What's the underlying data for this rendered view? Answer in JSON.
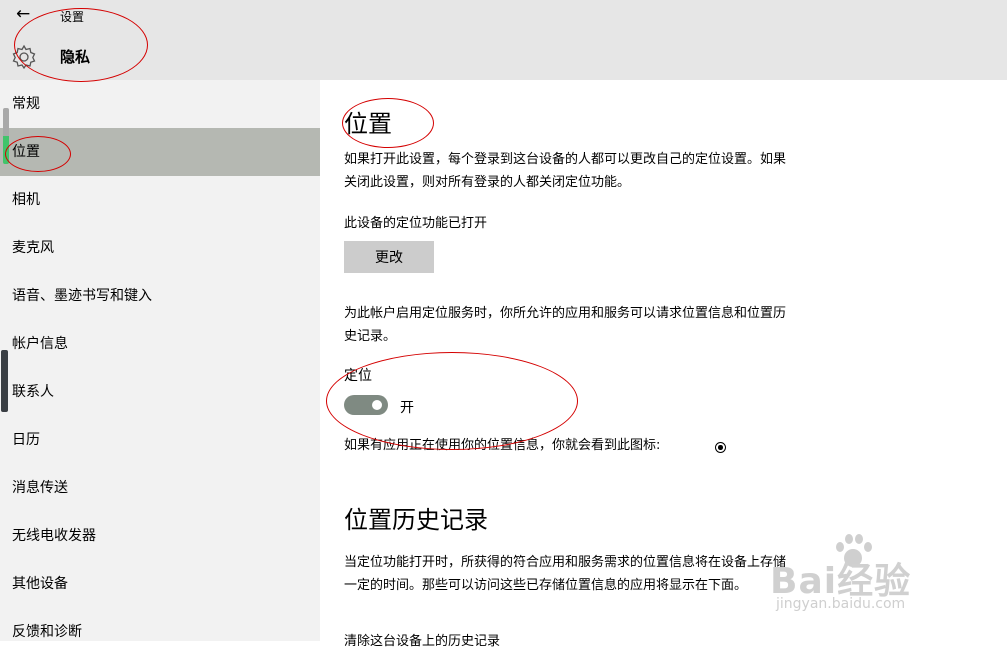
{
  "header": {
    "window_title": "设置",
    "page_heading": "隐私"
  },
  "sidebar": {
    "items": [
      {
        "label": "常规"
      },
      {
        "label": "位置"
      },
      {
        "label": "相机"
      },
      {
        "label": "麦克风"
      },
      {
        "label": "语音、墨迹书写和键入"
      },
      {
        "label": "帐户信息"
      },
      {
        "label": "联系人"
      },
      {
        "label": "日历"
      },
      {
        "label": "消息传送"
      },
      {
        "label": "无线电收发器"
      },
      {
        "label": "其他设备"
      },
      {
        "label": "反馈和诊断"
      }
    ],
    "selected": "位置"
  },
  "main": {
    "section_title": "位置",
    "intro_text": "如果打开此设置，每个登录到这台设备的人都可以更改自己的定位设置。如果关闭此设置，则对所有登录的人都关闭定位功能。",
    "device_status": "此设备的定位功能已打开",
    "change_button": "更改",
    "account_text": "为此帐户启用定位服务时，你所允许的应用和服务可以请求位置信息和位置历史记录。",
    "location_label": "定位",
    "toggle_state": "开",
    "toggle_on": true,
    "icon_hint": "如果有应用正在使用你的位置信息，你就会看到此图标:",
    "history_title": "位置历史记录",
    "history_text": "当定位功能打开时，所获得的符合应用和服务需求的位置信息将在设备上存储一定的时间。那些可以访问这些已存储位置信息的应用将显示在下面。",
    "clear_history_partial": "清除这台设备上的历史记录"
  },
  "watermark": {
    "brand": "Bai经验",
    "url": "jingyan.baidu.com"
  },
  "colors": {
    "header_bg": "#e6e6e6",
    "sidebar_bg": "#f2f2f2",
    "selected_bg": "#b5b8b2",
    "toggle_on": "#7f8a82",
    "button_bg": "#cccccc",
    "annotation": "#d40000"
  }
}
